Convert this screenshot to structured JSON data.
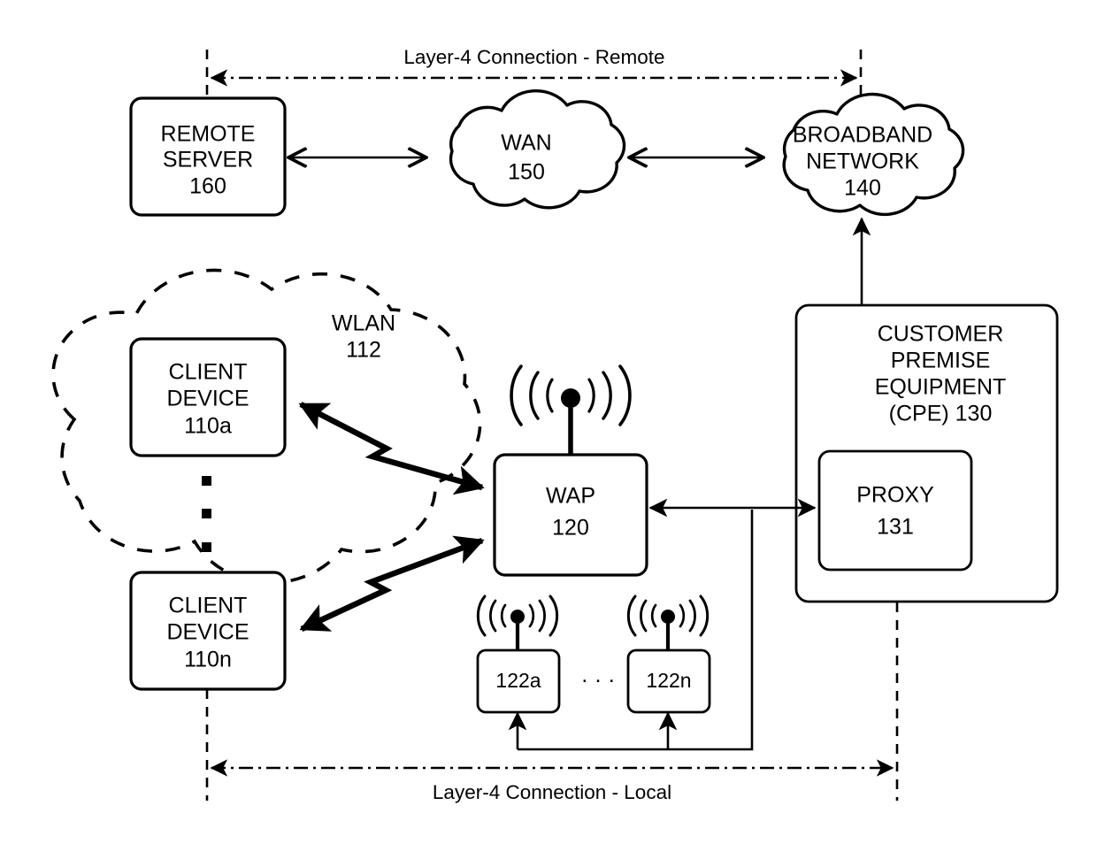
{
  "figure": {
    "title": "Network architecture with WAP, CPE proxy and layer-4 connections"
  },
  "spans": {
    "remote_label": "Layer-4 Connection - Remote",
    "local_label": "Layer-4 Connection - Local"
  },
  "nodes": {
    "remote_server": {
      "line1": "REMOTE",
      "line2": "SERVER",
      "ref": "160"
    },
    "wan": {
      "line1": "WAN",
      "ref": "150"
    },
    "broadband": {
      "line1": "BROADBAND",
      "line2": "NETWORK",
      "ref": "140"
    },
    "wlan": {
      "line1": "WLAN",
      "ref": "112"
    },
    "client_a": {
      "line1": "CLIENT",
      "line2": "DEVICE",
      "ref": "110a"
    },
    "client_n": {
      "line1": "CLIENT",
      "line2": "DEVICE",
      "ref": "110n"
    },
    "wap": {
      "line1": "WAP",
      "ref": "120"
    },
    "cpe": {
      "line1": "CUSTOMER",
      "line2": "PREMISE",
      "line3": "EQUIPMENT",
      "line4": "(CPE) 130"
    },
    "proxy": {
      "line1": "PROXY",
      "ref": "131"
    },
    "ssid_a": {
      "ref": "122a"
    },
    "ssid_n": {
      "ref": "122n"
    },
    "ssid_ellipsis": "·  ·  ·"
  },
  "icons": {
    "antenna_wap": "wifi-antenna-icon",
    "antenna_ssid_a": "wifi-antenna-icon",
    "antenna_ssid_n": "wifi-antenna-icon",
    "vertical_ellipsis": "vertical-ellipsis-icon"
  },
  "colors": {
    "stroke": "#000000",
    "background": "#ffffff"
  }
}
